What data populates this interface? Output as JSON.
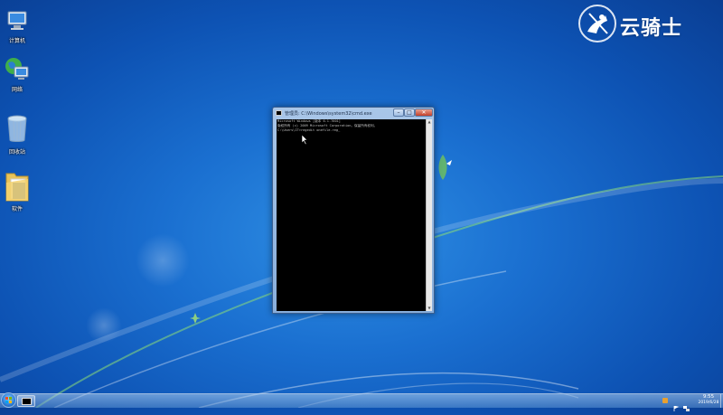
{
  "desktop": {
    "icons": [
      {
        "label": "计算机",
        "icon": "computer-icon"
      },
      {
        "label": "网络",
        "icon": "network-icon"
      },
      {
        "label": "回收站",
        "icon": "recycle-bin-icon"
      },
      {
        "label": "软件",
        "icon": "folder-icon"
      }
    ],
    "logo_text": "云骑士"
  },
  "cmd_window": {
    "title": "管理员: C:\\Windows\\system32\\cmd.exe",
    "lines": [
      "Microsoft Windows [版本 6.1.7601]",
      "版权所有 (c) 2009 Microsoft Corporation。保留所有权利。",
      "",
      "C:\\Users\\IT>regedit onefile.reg_"
    ],
    "minimize_label": "–",
    "maximize_label": "□",
    "close_label": "✕"
  },
  "taskbar": {
    "clock_time": "9:55",
    "clock_date": "2019/6/28"
  },
  "colors": {
    "desktop_blue": "#1a6fd0",
    "console_bg": "#000000",
    "console_text": "#c0c0c0",
    "close_red": "#c4402a"
  }
}
